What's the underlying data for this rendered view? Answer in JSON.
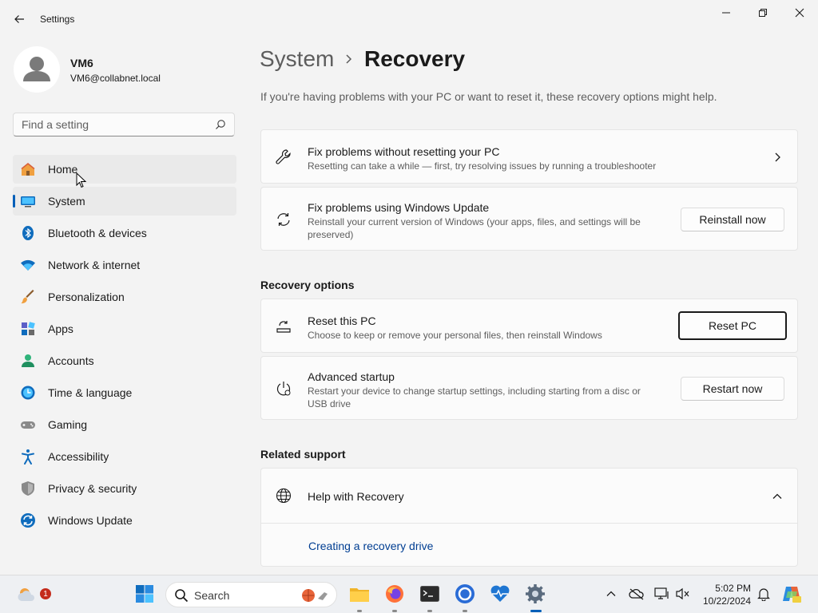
{
  "window": {
    "title": "Settings"
  },
  "profile": {
    "name": "VM6",
    "email": "VM6@collabnet.local"
  },
  "search": {
    "placeholder": "Find a setting"
  },
  "nav": {
    "items": [
      {
        "label": "Home",
        "icon": "home-icon"
      },
      {
        "label": "System",
        "icon": "system-icon"
      },
      {
        "label": "Bluetooth & devices",
        "icon": "bluetooth-icon"
      },
      {
        "label": "Network & internet",
        "icon": "wifi-icon"
      },
      {
        "label": "Personalization",
        "icon": "brush-icon"
      },
      {
        "label": "Apps",
        "icon": "apps-icon"
      },
      {
        "label": "Accounts",
        "icon": "accounts-icon"
      },
      {
        "label": "Time & language",
        "icon": "clock-globe-icon"
      },
      {
        "label": "Gaming",
        "icon": "gamepad-icon"
      },
      {
        "label": "Accessibility",
        "icon": "accessibility-icon"
      },
      {
        "label": "Privacy & security",
        "icon": "shield-icon"
      },
      {
        "label": "Windows Update",
        "icon": "update-icon"
      }
    ]
  },
  "breadcrumb": {
    "parent": "System",
    "current": "Recovery"
  },
  "intro": "If you're having problems with your PC or want to reset it, these recovery options might help.",
  "cards": {
    "fix_no_reset": {
      "title": "Fix problems without resetting your PC",
      "desc": "Resetting can take a while — first, try resolving issues by running a troubleshooter"
    },
    "fix_update": {
      "title": "Fix problems using Windows Update",
      "desc": "Reinstall your current version of Windows (your apps, files, and settings will be preserved)",
      "button": "Reinstall now"
    }
  },
  "recovery_options": {
    "heading": "Recovery options",
    "reset": {
      "title": "Reset this PC",
      "desc": "Choose to keep or remove your personal files, then reinstall Windows",
      "button": "Reset PC"
    },
    "advanced": {
      "title": "Advanced startup",
      "desc": "Restart your device to change startup settings, including starting from a disc or USB drive",
      "button": "Restart now"
    }
  },
  "related_support": {
    "heading": "Related support",
    "help": {
      "title": "Help with Recovery",
      "link": "Creating a recovery drive"
    }
  },
  "taskbar": {
    "search_label": "Search",
    "weather_badge": "1",
    "time": "5:02 PM",
    "date": "10/22/2024"
  },
  "colors": {
    "accent": "#005fb8",
    "link": "#003e92"
  }
}
